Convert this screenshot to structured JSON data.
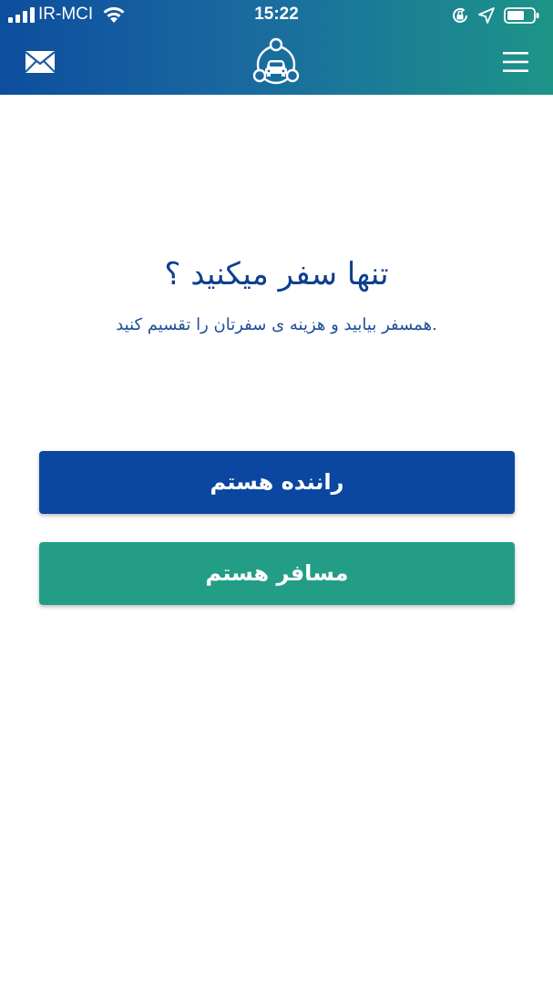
{
  "status_bar": {
    "carrier": "IR-MCI",
    "time": "15:22"
  },
  "icons": {
    "mail": "envelope-icon",
    "logo": "car-network-logo",
    "menu": "hamburger-menu-icon"
  },
  "main": {
    "title": "تنها سفر میکنید ؟",
    "subtitle": ".همسفر بیابید و هزینه ی سفرتان را تقسیم کنید"
  },
  "buttons": {
    "driver_label": "راننده هستم",
    "passenger_label": "مسافر هستم"
  },
  "colors": {
    "header_start": "#0d4e9e",
    "header_end": "#1d9488",
    "driver_button": "#0b47a0",
    "passenger_button": "#239d86",
    "title_text": "#0f3f8f"
  }
}
